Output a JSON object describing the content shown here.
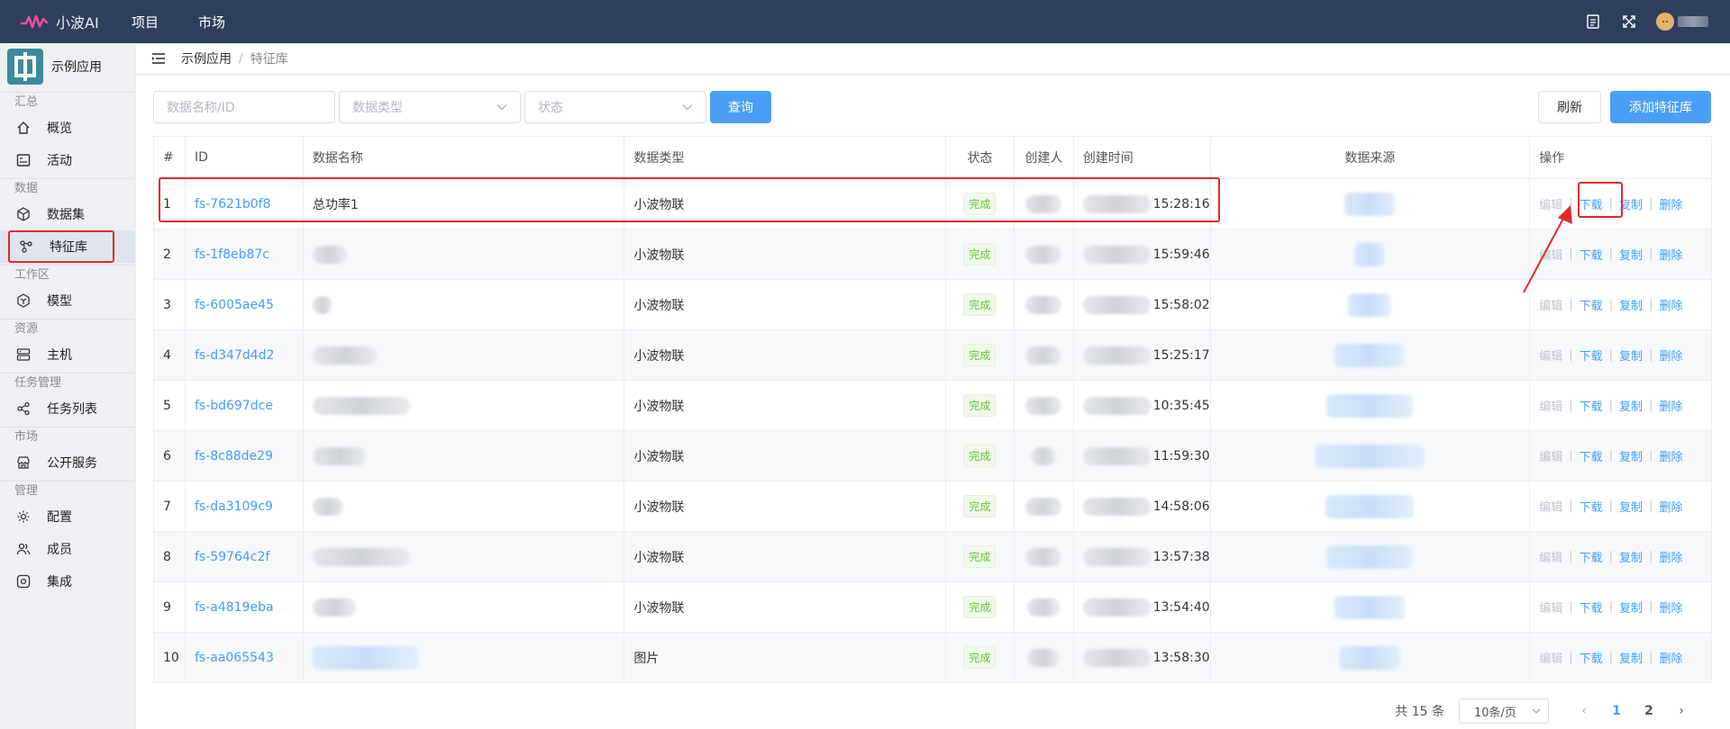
{
  "topbar": {
    "logo_text": "小波AI",
    "nav": [
      "项目",
      "市场"
    ]
  },
  "sidebar": {
    "app_name": "示例应用",
    "groups": [
      {
        "label": "汇总",
        "items": [
          {
            "label": "概览",
            "icon": "home-icon"
          },
          {
            "label": "活动",
            "icon": "activity-icon"
          }
        ]
      },
      {
        "label": "数据",
        "items": [
          {
            "label": "数据集",
            "icon": "cube-icon"
          },
          {
            "label": "特征库",
            "icon": "feature-icon",
            "active": true
          }
        ]
      },
      {
        "label": "工作区",
        "items": [
          {
            "label": "模型",
            "icon": "model-icon"
          }
        ]
      },
      {
        "label": "资源",
        "items": [
          {
            "label": "主机",
            "icon": "server-icon"
          }
        ]
      },
      {
        "label": "任务管理",
        "items": [
          {
            "label": "任务列表",
            "icon": "share-icon"
          }
        ]
      },
      {
        "label": "市场",
        "items": [
          {
            "label": "公开服务",
            "icon": "store-icon"
          }
        ]
      },
      {
        "label": "管理",
        "items": [
          {
            "label": "配置",
            "icon": "gear-icon"
          },
          {
            "label": "成员",
            "icon": "users-icon"
          },
          {
            "label": "集成",
            "icon": "integration-icon"
          }
        ]
      }
    ]
  },
  "breadcrumb": {
    "root": "示例应用",
    "sep": "/",
    "current": "特征库"
  },
  "filters": {
    "name_placeholder": "数据名称/ID",
    "type_placeholder": "数据类型",
    "status_placeholder": "状态",
    "query_label": "查询"
  },
  "actions": {
    "refresh_label": "刷新",
    "add_label": "添加特征库"
  },
  "table": {
    "headers": [
      "#",
      "ID",
      "数据名称",
      "数据类型",
      "状态",
      "创建人",
      "创建时间",
      "数据来源",
      "操作"
    ],
    "rows": [
      {
        "idx": "1",
        "id": "fs-7621b0f8",
        "name": "总功率1",
        "type": "小波物联",
        "status": "完成",
        "time": "15:28:16"
      },
      {
        "idx": "2",
        "id": "fs-1f8eb87c",
        "name": "",
        "type": "小波物联",
        "status": "完成",
        "time": "15:59:46"
      },
      {
        "idx": "3",
        "id": "fs-6005ae45",
        "name": "",
        "type": "小波物联",
        "status": "完成",
        "time": "15:58:02"
      },
      {
        "idx": "4",
        "id": "fs-d347d4d2",
        "name": "",
        "type": "小波物联",
        "status": "完成",
        "time": "15:25:17"
      },
      {
        "idx": "5",
        "id": "fs-bd697dce",
        "name": "",
        "type": "小波物联",
        "status": "完成",
        "time": "10:35:45"
      },
      {
        "idx": "6",
        "id": "fs-8c88de29",
        "name": "",
        "type": "小波物联",
        "status": "完成",
        "time": "11:59:30"
      },
      {
        "idx": "7",
        "id": "fs-da3109c9",
        "name": "",
        "type": "小波物联",
        "status": "完成",
        "time": "14:58:06"
      },
      {
        "idx": "8",
        "id": "fs-59764c2f",
        "name": "",
        "type": "小波物联",
        "status": "完成",
        "time": "13:57:38"
      },
      {
        "idx": "9",
        "id": "fs-a4819eba",
        "name": "",
        "type": "小波物联",
        "status": "完成",
        "time": "13:54:40"
      },
      {
        "idx": "10",
        "id": "fs-aa065543",
        "name": "",
        "type": "图片",
        "status": "完成",
        "time": "13:58:30"
      }
    ],
    "ops": {
      "edit": "编辑",
      "download": "下载",
      "copy": "复制",
      "delete": "删除",
      "sep": "|"
    }
  },
  "pagination": {
    "total": "共 15 条",
    "page_size": "10条/页",
    "pages": [
      "1",
      "2"
    ],
    "current_page": "1"
  },
  "colors": {
    "topbar": "#2f3e5c",
    "primary": "#4a9ff5",
    "link": "#409eff",
    "highlight": "#e12b2b",
    "success": "#67c23a"
  }
}
